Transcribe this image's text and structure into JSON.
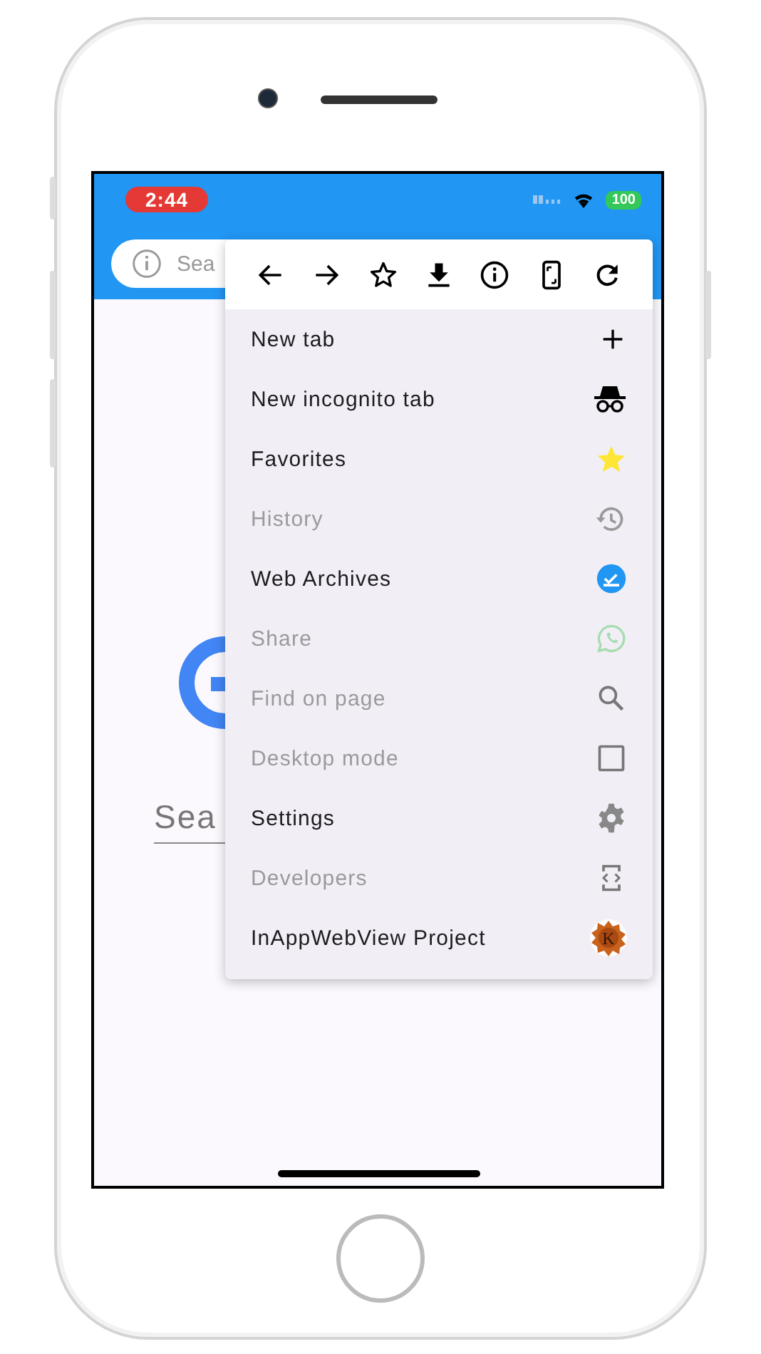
{
  "status_bar": {
    "time": "2:44",
    "battery": "100"
  },
  "search": {
    "placeholder": "Sea"
  },
  "page": {
    "search_text": "Sea"
  },
  "menu": {
    "toolbar": [
      {
        "kind": "back"
      },
      {
        "kind": "forward"
      },
      {
        "kind": "star"
      },
      {
        "kind": "download"
      },
      {
        "kind": "info"
      },
      {
        "kind": "rotate"
      },
      {
        "kind": "refresh"
      }
    ],
    "items": [
      {
        "label": "New tab",
        "disabled": false,
        "kind": "plus"
      },
      {
        "label": "New incognito tab",
        "disabled": false,
        "kind": "incognito"
      },
      {
        "label": "Favorites",
        "disabled": false,
        "kind": "star"
      },
      {
        "label": "History",
        "disabled": true,
        "kind": "history"
      },
      {
        "label": "Web Archives",
        "disabled": false,
        "kind": "archive"
      },
      {
        "label": "Share",
        "disabled": true,
        "kind": "chat"
      },
      {
        "label": "Find on page",
        "disabled": true,
        "kind": "search"
      },
      {
        "label": "Desktop mode",
        "disabled": true,
        "kind": "checkbox"
      },
      {
        "label": "Settings",
        "disabled": false,
        "kind": "gear"
      },
      {
        "label": "Developers",
        "disabled": true,
        "kind": "developer"
      },
      {
        "label": "InAppWebView Project",
        "disabled": false,
        "kind": "avatar",
        "letter": "K"
      }
    ]
  }
}
